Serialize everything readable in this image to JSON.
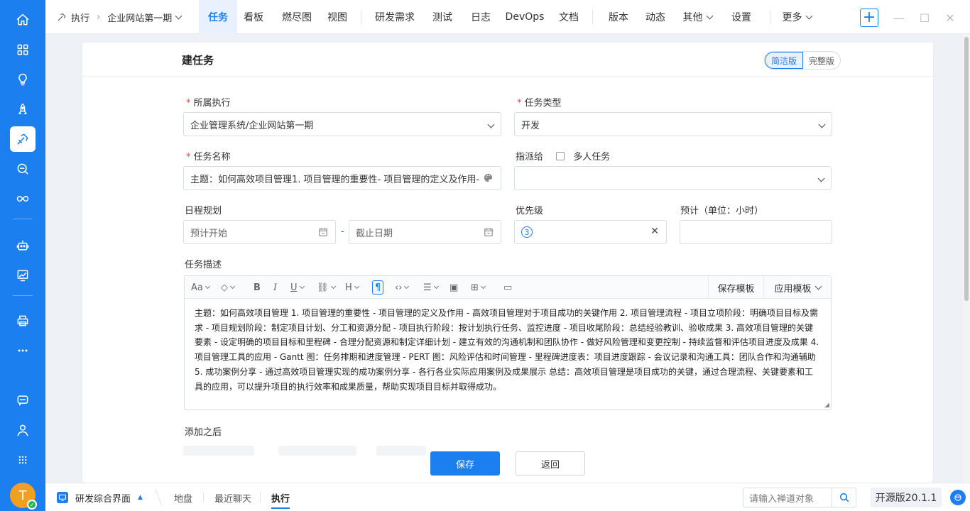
{
  "breadcrumb": {
    "module": "执行",
    "project": "企业网站第一期"
  },
  "nav": {
    "items": [
      "任务",
      "看板",
      "燃尽图",
      "视图",
      "研发需求",
      "测试",
      "日志",
      "DevOps",
      "文档",
      "版本",
      "动态",
      "其他",
      "设置",
      "更多"
    ],
    "active": "任务"
  },
  "form": {
    "title": "建任务",
    "mode": {
      "simple": "简洁版",
      "full": "完整版",
      "selected": "简洁版"
    },
    "execution": {
      "label": "所属执行",
      "value": "企业管理系统/企业网站第一期"
    },
    "task_type": {
      "label": "任务类型",
      "value": "开发"
    },
    "task_name": {
      "label": "任务名称",
      "value": "主题：如何高效项目管理1. 项目管理的重要性- 项目管理的定义及作用-"
    },
    "assignee": {
      "label": "指派给",
      "multi_label": "多人任务",
      "value": ""
    },
    "schedule": {
      "label": "日程规划",
      "start_placeholder": "预计开始",
      "separator": "-",
      "end_placeholder": "截止日期"
    },
    "priority": {
      "label": "优先级",
      "value": "3"
    },
    "estimate": {
      "label": "预计（单位：小时）",
      "value": ""
    },
    "description": {
      "label": "任务描述",
      "save_template": "保存模板",
      "apply_template": "应用模板",
      "content": "主题：如何高效项目管理 1. 项目管理的重要性 - 项目管理的定义及作用 - 高效项目管理对于项目成功的关键作用 2. 项目管理流程 - 项目立项阶段：明确项目目标及需求 - 项目规划阶段：制定项目计划、分工和资源分配 - 项目执行阶段：按计划执行任务、监控进度 - 项目收尾阶段：总结经验教训、验收成果 3. 高效项目管理的关键要素 - 设定明确的项目目标和里程碑 - 合理分配资源和制定详细计划 - 建立有效的沟通机制和团队协作 - 做好风险管理和变更控制 - 持续监督和评估项目进度及成果 4. 项目管理工具的应用 - Gantt 图：任务排期和进度管理 - PERT 图：风险评估和时间管理 - 里程碑进度表：项目进度跟踪 - 会议记录和沟通工具：团队合作和沟通辅助 5. 成功案例分享 - 通过高效项目管理实现的成功案例分享 - 各行各业实际应用案例及成果展示 总结：高效项目管理是项目成功的关键，通过合理流程、关键要素和工具的应用，可以提升项目的执行效率和成果质量，帮助实现项目目标并取得成功。"
    },
    "after_add": {
      "label": "添加之后"
    },
    "save": "保存",
    "back": "返回"
  },
  "bottombar": {
    "workspace": "研发综合界面",
    "tabs": [
      "地盘",
      "最近聊天",
      "执行"
    ],
    "active_tab": "执行",
    "search_placeholder": "请输入禅道对象",
    "version": "开源版20.1.1"
  },
  "user": {
    "initial": "T"
  },
  "colors": {
    "primary": "#1c7ff0",
    "required": "#e8453c"
  }
}
